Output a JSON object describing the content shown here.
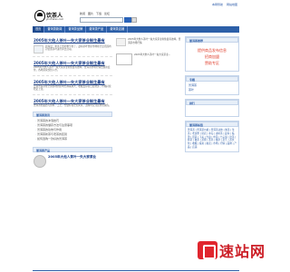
{
  "topbar": {
    "links": [
      "本网导航",
      "网站地图"
    ]
  },
  "header": {
    "brand_name": "饮茶人",
    "brand_domain": "yincharen.com",
    "nav_links": [
      "新闻",
      "图片",
      "下载",
      "论坛"
    ],
    "search_placeholder": ""
  },
  "nav": {
    "items": [
      "首页",
      "普洱茶新闻",
      "普洱茶品牌",
      "普洱茶产品",
      "普洱茶店铺"
    ]
  },
  "left": {
    "articles": [
      {
        "title": "2005年大他人茶叶一失大家茶业制生最有",
        "text": "勐海县：新茶上市的季节到了，勐海茶叶交易市场在全县范围内对优质茶叶进行评比活动。"
      },
      {
        "title": "2005年大他人茶叶一失大家茶业制生最有",
        "text": "2005年大他人茶叶一失大家茶业制生最有效率，普洱茶市场行情出现新变化，各地商家纷纷入市。"
      },
      {
        "title": "2005年大他人茶叶一失大家茶业制生最有",
        "text": "云南普洱茶在全国各地的影响力越来越大，收藏爱好者日益增多，价格持续稳定上涨。"
      },
      {
        "title": "2005年大他人茶叶一失大家茶业制生最有",
        "text": "普洱茶的品质与原料、工艺、仓储有着密切关系，选购时应注意辨别真伪。"
      }
    ],
    "news_head": "普洱茶资讯",
    "news_list": [
      "普洱茶的冲泡技巧",
      "普洱茶的储存方法与注意事项",
      "普洱茶的功效与作用",
      "普洱茶新茶与老茶的区别",
      "如何选购一款好的普洱茶"
    ],
    "product_head": "普洱茶产品",
    "product_title": "2005年大他人茶叶一失大家茶业"
  },
  "mid": {
    "img_caption": "2005年大他人茶叶一失大家茶业制生最有效率，普洱茶市场行情",
    "row_caption": "2005年大他人茶叶一失大家茶业..."
  },
  "right": {
    "head1": "普洱茶推荐",
    "promo_lines": [
      "提供商品发布信息",
      "招商加盟",
      "赞助专区"
    ],
    "head2": "专题",
    "list2": [
      "普洱茶",
      "茶叶"
    ],
    "head3": "排行",
    "head4": "普洱茶标签",
    "tags": "普洱茶 | 普洱茶价格 | 普洱茶功效 | 熟茶 | 生茶 | 老班章 | 易武 | 冰岛 | 古树茶 | 勐海 | 临沧 | 思茅 | 下关 | 大益 | 中茶 | 七子饼 | 沱茶 | 砖茶 | 散茶 | 茶膏 | 茶具 | 紫砂 | 茶艺 | 茶文化 | 收藏 | 投资 | 拍卖 | 市场 | 行情 | 品牌 | 产品 | 店铺"
  },
  "watermark": {
    "text": "速站网"
  }
}
